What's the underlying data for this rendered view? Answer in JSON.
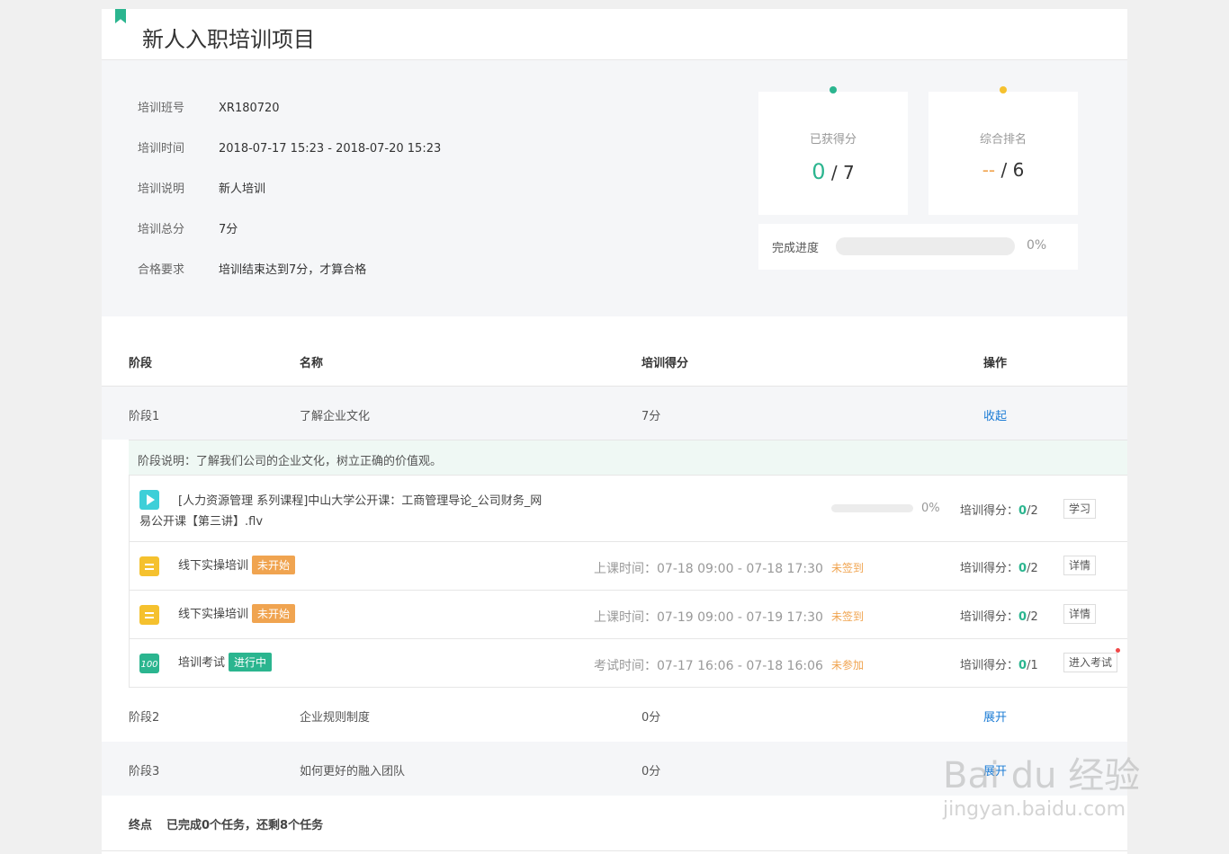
{
  "title": "新人入职培训项目",
  "info": [
    {
      "label": "培训班号",
      "value": "XR180720"
    },
    {
      "label": "培训时间",
      "value": "2018-07-17 15:23 - 2018-07-20 15:23"
    },
    {
      "label": "培训说明",
      "value": "新人培训"
    },
    {
      "label": "培训总分",
      "value": "7分"
    },
    {
      "label": "合格要求",
      "value": "培训结束达到7分，才算合格"
    }
  ],
  "score_card": {
    "label": "已获得分",
    "value": "0",
    "total": "/ 7",
    "dot_color": "#2bb58f",
    "value_color": "#2bb58f"
  },
  "rank_card": {
    "label": "综合排名",
    "value": "--",
    "total": "/ 6",
    "dot_color": "#f5c12e",
    "value_color": "#f0a450"
  },
  "progress": {
    "label": "完成进度",
    "percent": "0%",
    "fraction": 0
  },
  "table_headers": {
    "stage": "阶段",
    "name": "名称",
    "score": "培训得分",
    "op": "操作"
  },
  "stages": [
    {
      "stage": "阶段1",
      "name": "了解企业文化",
      "score": "7分",
      "op": "收起"
    },
    {
      "stage": "阶段2",
      "name": "企业规则制度",
      "score": "0分",
      "op": "展开"
    },
    {
      "stage": "阶段3",
      "name": "如何更好的融入团队",
      "score": "0分",
      "op": "展开"
    }
  ],
  "stage_desc": "阶段说明：了解我们公司的企业文化，树立正确的价值观。",
  "tasks": [
    {
      "name_line1": "[人力资源管理 系列课程]中山大学公开课：工商管理导论_公司财务_网",
      "name_line2": "易公开课【第三讲】.flv",
      "percent": "0%",
      "score_label": "培训得分：",
      "score": "0",
      "score_total": "/2",
      "button": "学习"
    },
    {
      "name": "线下实操培训",
      "badge": "未开始",
      "time": "上课时间：07-18 09:00 - 07-18 17:30",
      "status": "未签到",
      "score_label": "培训得分：",
      "score": "0",
      "score_total": "/2",
      "button": "详情"
    },
    {
      "name": "线下实操培训",
      "badge": "未开始",
      "time": "上课时间：07-19 09:00 - 07-19 17:30",
      "status": "未签到",
      "score_label": "培训得分：",
      "score": "0",
      "score_total": "/2",
      "button": "详情"
    },
    {
      "name": "培训考试",
      "badge": "进行中",
      "time": "考试时间：07-17 16:06 - 07-18 16:06",
      "status": "未参加",
      "score_label": "培训得分：",
      "score": "0",
      "score_total": "/1",
      "button": "进入考试"
    }
  ],
  "footer": {
    "label": "终点",
    "text": "已完成0个任务，还剩8个任务"
  },
  "watermark": {
    "line1": "Bai du 经验",
    "line2": "jingyan.baidu.com"
  }
}
